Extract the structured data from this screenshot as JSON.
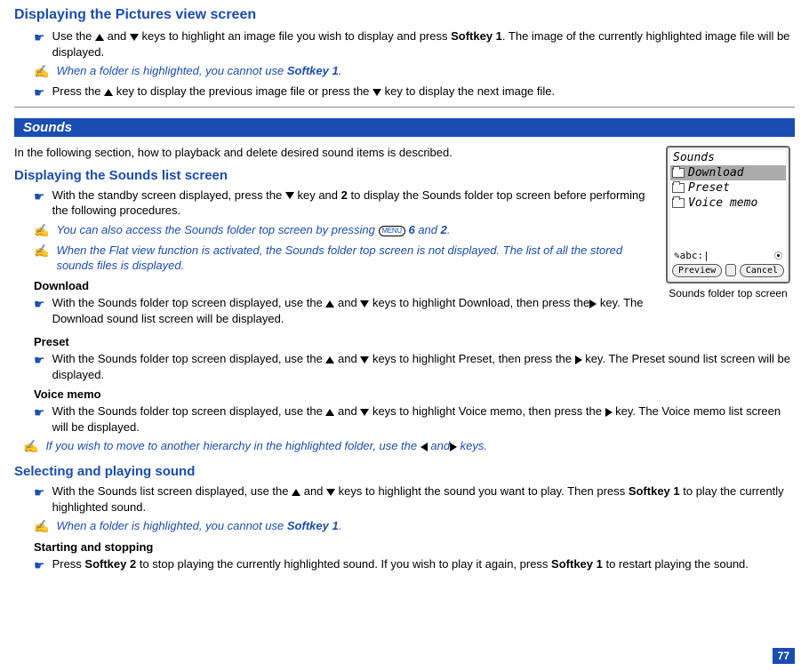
{
  "section1": {
    "title": "Displaying the Pictures view screen",
    "b1_a": "Use the ",
    "b1_b": " and ",
    "b1_c": " keys to highlight an image file you wish to display and press ",
    "b1_softkey": "Softkey 1",
    "b1_d": ". The image of the currently highlighted image file will be displayed.",
    "tip1_a": "When a folder is highlighted, you cannot use ",
    "tip1_softkey": "Softkey 1",
    "tip1_b": ".",
    "b2_a": "Press the ",
    "b2_b": " key to display the previous image file or press the ",
    "b2_c": " key to display the next image file."
  },
  "banner": "Sounds",
  "intro": "In the following section, how to playback and delete desired sound items is described.",
  "section2": {
    "title": "Displaying the Sounds list screen",
    "b1_a": "With the standby screen displayed, press the ",
    "b1_b": " key and ",
    "b1_num": "2",
    "b1_c": " to display the Sounds folder top screen before performing the following procedures.",
    "tip1_a": "You can also access the Sounds folder top screen by pressing ",
    "tip1_menu": "MENU",
    "tip1_b": " ",
    "tip1_num6": "6",
    "tip1_c": " and ",
    "tip1_num2": "2",
    "tip1_d": ".",
    "tip2": "When the Flat view function is activated, the Sounds folder top screen is not displayed. The list of all the stored sounds files is displayed.",
    "download_heading": "Download",
    "download_a": "With the Sounds folder top screen displayed, use the ",
    "download_b": " and ",
    "download_c": " keys to highlight Download, then press the",
    "download_d": " key. The Download sound list screen will be displayed.",
    "preset_heading": "Preset",
    "preset_a": "With the Sounds folder top screen displayed, use the ",
    "preset_b": " and ",
    "preset_c": " keys to highlight Preset, then press the ",
    "preset_d": " key. The Preset sound list screen will be displayed.",
    "voice_heading": "Voice memo",
    "voice_a": "With the Sounds folder top screen displayed, use the ",
    "voice_b": " and ",
    "voice_c": " keys to highlight Voice memo, then press the ",
    "voice_d": " key. The Voice memo list screen will be displayed.",
    "tip3_a": "If you wish to move to another hierarchy in the highlighted folder, use the ",
    "tip3_b": " and",
    "tip3_c": " keys."
  },
  "screen": {
    "title": "Sounds",
    "items": [
      "Download",
      "Preset",
      "Voice memo"
    ],
    "input_mode": "abc",
    "left_softkey": "Preview",
    "right_softkey": "Cancel",
    "caption": "Sounds folder top screen"
  },
  "section3": {
    "title": "Selecting and playing sound",
    "b1_a": "With the Sounds list screen displayed, use the ",
    "b1_b": " and ",
    "b1_c": " keys to highlight the sound you want to play. Then press ",
    "b1_softkey": "Softkey 1",
    "b1_d": " to play the currently highlighted sound.",
    "tip1_a": "When a folder is highlighted, you cannot use ",
    "tip1_softkey": "Softkey 1",
    "tip1_b": ".",
    "start_heading": "Starting and stopping",
    "start_a": "Press ",
    "start_sk2": "Softkey 2",
    "start_b": " to stop playing the currently highlighted sound. If you wish to play it again, press ",
    "start_sk1": "Softkey 1",
    "start_c": " to restart playing the sound."
  },
  "page_number": "77"
}
